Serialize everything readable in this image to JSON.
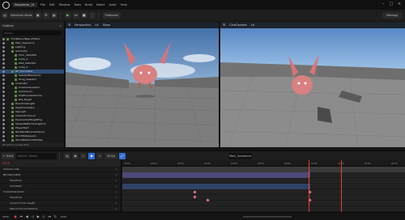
{
  "app": {
    "tab_title": "Sequencer_01",
    "menu": [
      "File",
      "Edit",
      "Window",
      "Tools",
      "Build",
      "Select",
      "Actor",
      "Help"
    ]
  },
  "toolbar": {
    "mode_label": "Selection Mode",
    "play_label": "Platforms",
    "settings_label": "Settings"
  },
  "outliner": {
    "title": "Outliner",
    "search_placeholder": "Search...",
    "items": [
      "ThirdPersonMap (Editor)",
      "Main_Sequence",
      "Lighting",
      "Geometry",
      "Floor_400x400",
      "Cube_2",
      "Wall_400x300",
      "Cube_3",
      "BP_DemonBat",
      "SkeletalMeshActor",
      "Wing_Skeleton",
      "Cinematic",
      "CineCameraActor",
      "Camera_01",
      "PostProcessVolume",
      "Bat_Target",
      "DirectionalLight",
      "SkyAtmosphere",
      "SkyLight",
      "VolumetricCloud",
      "ExponentialHeightFog",
      "SphereReflectionCapture",
      "PlayerStart",
      "NavMeshBoundsVolume",
      "WorldDataLayers",
      "WorldPartitionMiniMap"
    ],
    "selected_index": 8,
    "footer": "26 actors (1 selected)"
  },
  "viewport_left": {
    "label": "Perspective",
    "lit_label": "Lit",
    "show_label": "Show"
  },
  "viewport_right": {
    "label": "CineCamera",
    "lit_label": "Lit"
  },
  "sequencer": {
    "title": "Main_Sequence",
    "add_label": "+ Track",
    "search_placeholder": "Search Tracks",
    "fps": "30 fps",
    "current_frame": "0070",
    "tracks": [
      "Camera Cuts",
      "BP_DemonBat",
      "Transform",
      "Animation",
      "CineCameraActor",
      "Transform",
      "Current Focal Length",
      "Manual Focus Distance"
    ],
    "start_frame": "0000",
    "end_frame": "0150",
    "timecodes": [
      "0000",
      "0015",
      "0030",
      "0045",
      "0060",
      "0075",
      "0090",
      "0105",
      "0120",
      "0135",
      "0150"
    ]
  },
  "colors": {
    "accent": "#2d6fd6",
    "key": "#e86a9a",
    "playhead": "#e2413b"
  }
}
